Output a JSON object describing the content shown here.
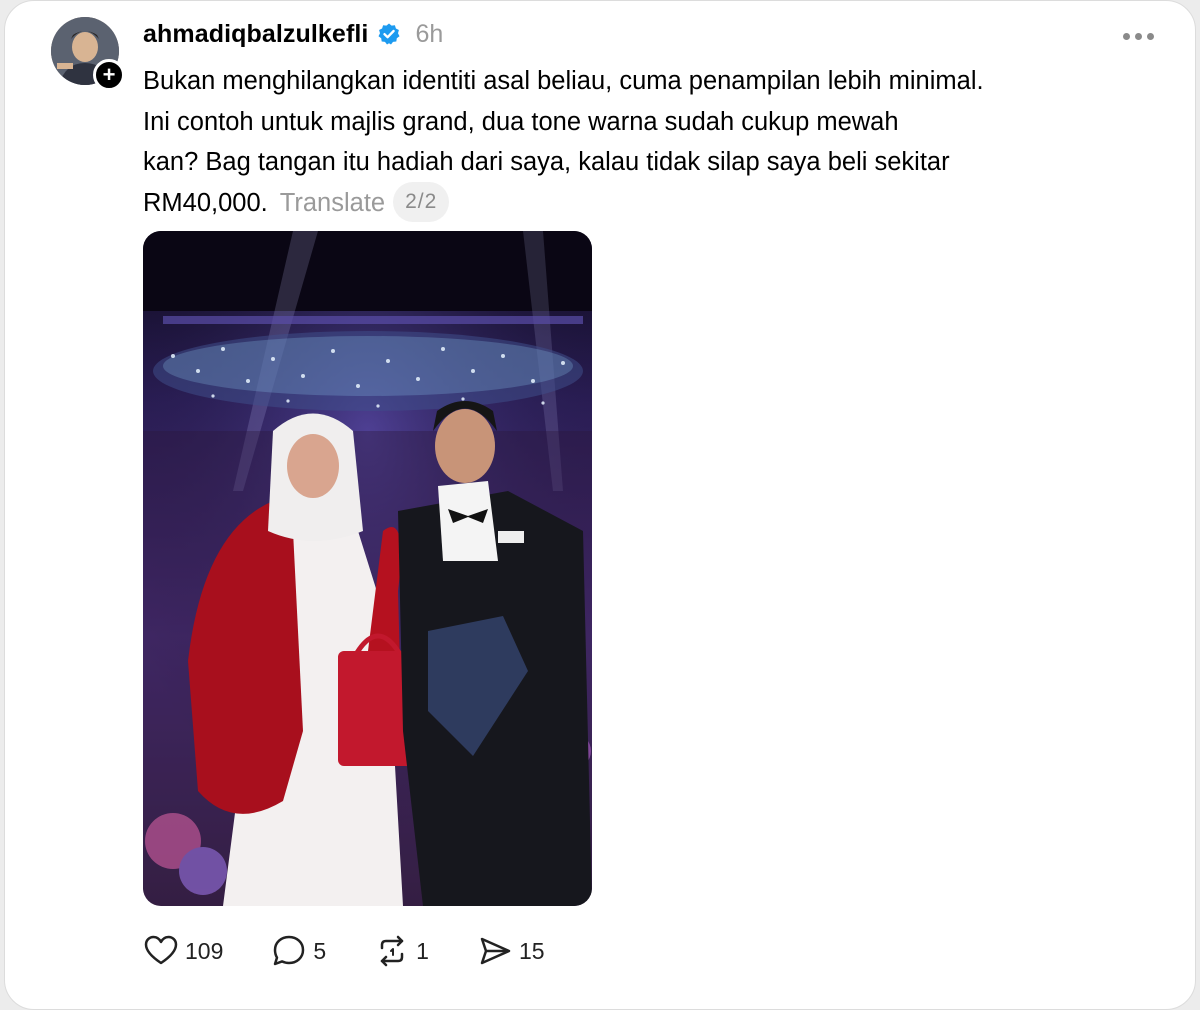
{
  "post": {
    "username": "ahmadiqbalzulkefli",
    "time": "6h",
    "text_lines": [
      "Bukan menghilangkan identiti asal beliau, cuma penampilan lebih minimal.",
      "Ini contoh untuk majlis grand, dua tone warna sudah cukup mewah",
      "kan? Bag tangan itu hadiah dari saya, kalau tidak silap saya beli sekitar",
      "RM40,000."
    ],
    "translate_label": "Translate",
    "page_indicator": "2/2"
  },
  "actions": {
    "likes": "109",
    "replies": "5",
    "reposts": "1",
    "shares": "15"
  },
  "colors": {
    "verified": "#1d9bf0",
    "muted": "#9a9a9a"
  },
  "icons": {
    "like": "heart-icon",
    "reply": "speech-bubble-icon",
    "repost": "repost-arrows-icon",
    "share": "send-paper-plane-icon"
  }
}
